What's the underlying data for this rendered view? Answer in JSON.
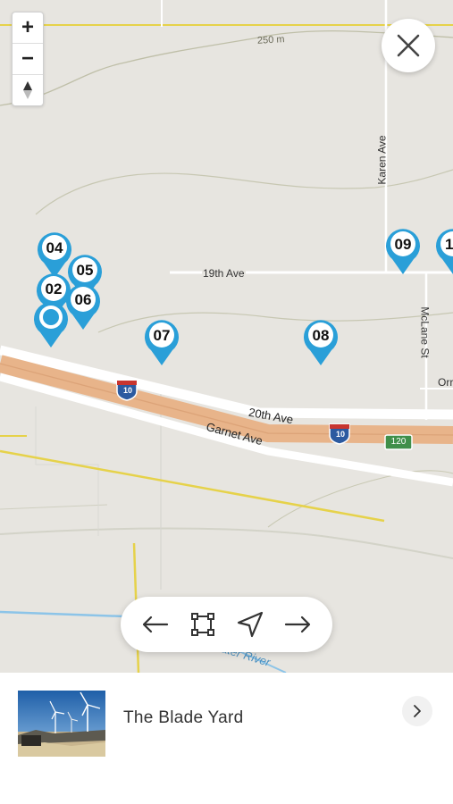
{
  "map": {
    "contour_label": "250 m",
    "roads": {
      "karen_ave": "Karen Ave",
      "nineteenth_ave": "19th Ave",
      "mclane_st": "McLane St",
      "orr_partial": "Orr",
      "twentieth_ave": "20th Ave",
      "garnet_ave": "Garnet Ave",
      "water_river": "ater River"
    },
    "shields": {
      "interstate_1": "10",
      "interstate_2": "10",
      "route_120": "120"
    },
    "pins": [
      "04",
      "05",
      "02",
      "06",
      "07",
      "08",
      "09",
      "1"
    ],
    "colors": {
      "pin": "#2a9fd8",
      "highway": "#e8b48a",
      "water": "#8cc4e8",
      "road_yellow": "#e6d24a"
    }
  },
  "controls": {
    "zoom_in": "+",
    "zoom_out": "−",
    "compass_icon": "compass-icon",
    "close_icon": "close-icon"
  },
  "nav": {
    "prev_icon": "arrow-left-icon",
    "fit_icon": "fit-bounds-icon",
    "locate_icon": "navigation-icon",
    "next_icon": "arrow-right-icon"
  },
  "card": {
    "title": "The Blade Yard",
    "thumbnail_icon": "wind-turbines-photo"
  }
}
